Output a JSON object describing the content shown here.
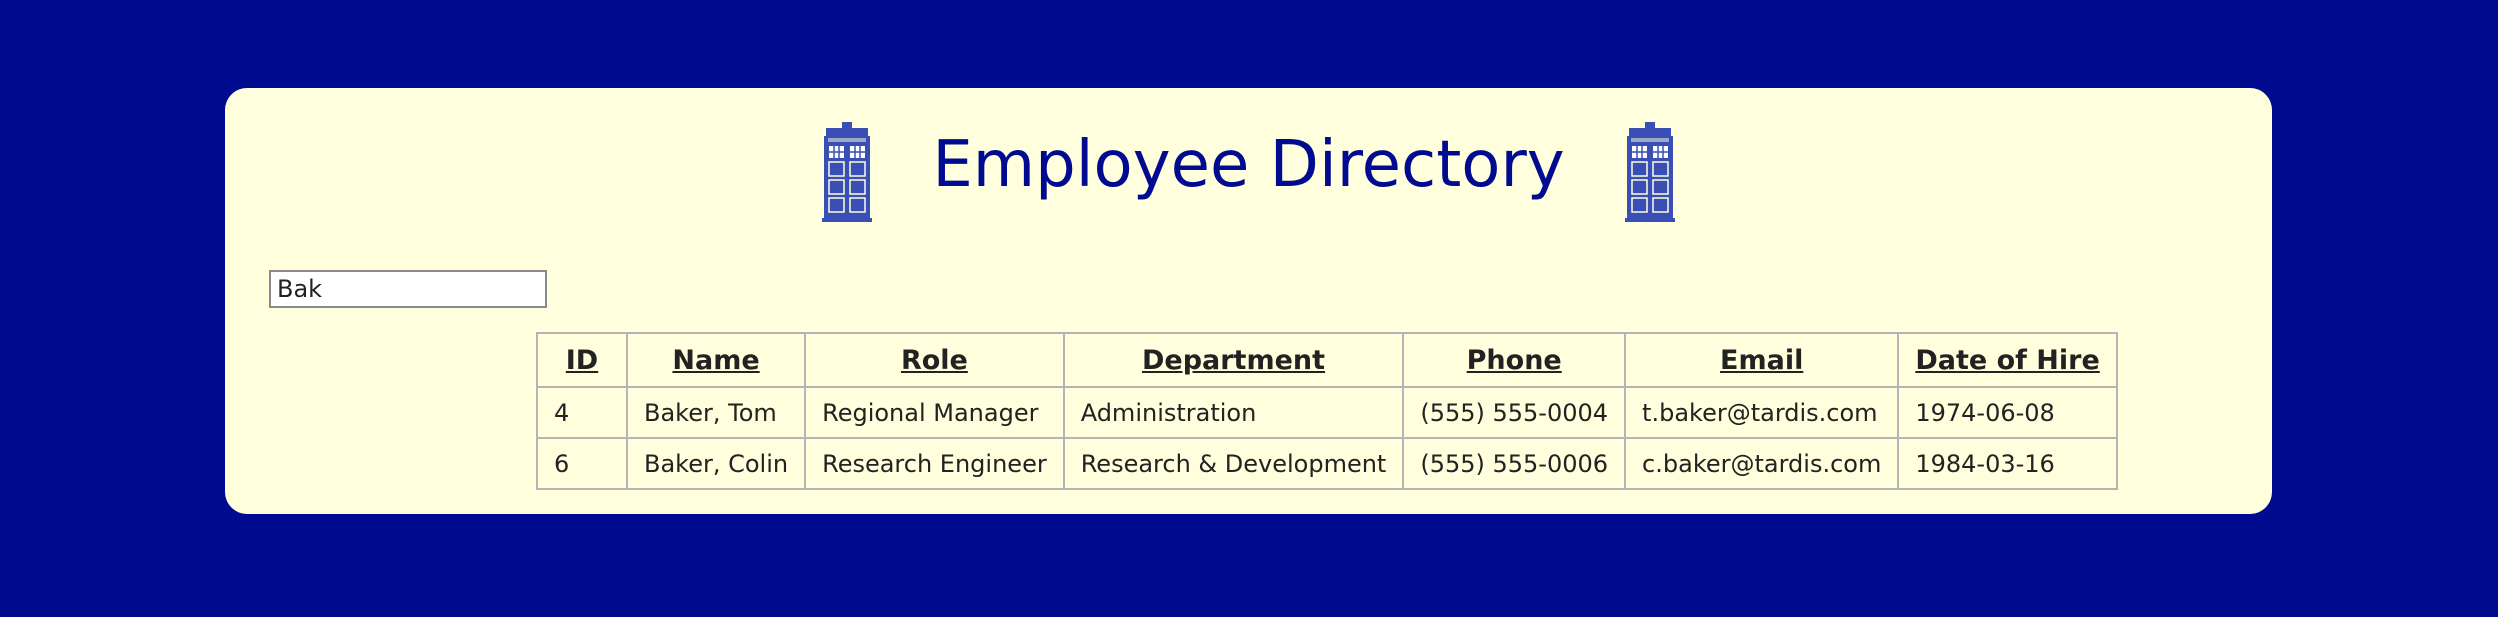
{
  "header": {
    "title": "Employee Directory"
  },
  "search": {
    "value": "Bak"
  },
  "table": {
    "columns": [
      "ID",
      "Name",
      "Role",
      "Department",
      "Phone",
      "Email",
      "Date of Hire"
    ],
    "rows": [
      [
        "4",
        "Baker, Tom",
        "Regional Manager",
        "Administration",
        "(555) 555-0004",
        "t.baker@tardis.com",
        "1974-06-08"
      ],
      [
        "6",
        "Baker, Colin",
        "Research Engineer",
        "Research & Development",
        "(555) 555-0006",
        "c.baker@tardis.com",
        "1984-03-16"
      ]
    ]
  },
  "icons": {
    "left": "tardis-icon",
    "right": "tardis-icon"
  },
  "colors": {
    "page_background": "#000b8f",
    "card_background": "#ffffde",
    "title": "#000b8f",
    "tardis": "#3a4fb5"
  }
}
